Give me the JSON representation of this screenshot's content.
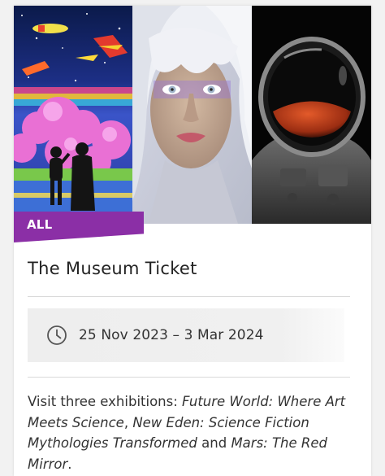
{
  "card": {
    "category": "ALL EXHIBITIONS",
    "title": "The Museum Ticket",
    "date_range": "25 Nov 2023 – 3 Mar 2024",
    "description": {
      "prefix": "Visit three exhibitions: ",
      "exhibition_1": "Future World: Where Art Meets Science",
      "sep_1": ", ",
      "exhibition_2": "New Eden: Science Fiction Mythologies Transformed",
      "sep_2": " and ",
      "exhibition_3": "Mars: The Red Mirror",
      "suffix": "."
    }
  },
  "images": [
    {
      "name": "future-world-artwork",
      "subject": "colourful painted scene with planes, pink trees and two silhouetted figures"
    },
    {
      "name": "new-eden-portrait",
      "subject": "portrait of a woman with white hair and violet eye makeup"
    },
    {
      "name": "mars-astronaut",
      "subject": "astronaut helmet reflecting the red planet Mars"
    }
  ],
  "icons": {
    "date": "clock-icon"
  },
  "colors": {
    "badge": "#8b2fa6",
    "title": "#222222",
    "body_text": "#333333",
    "date_box": "#eeeeee"
  }
}
